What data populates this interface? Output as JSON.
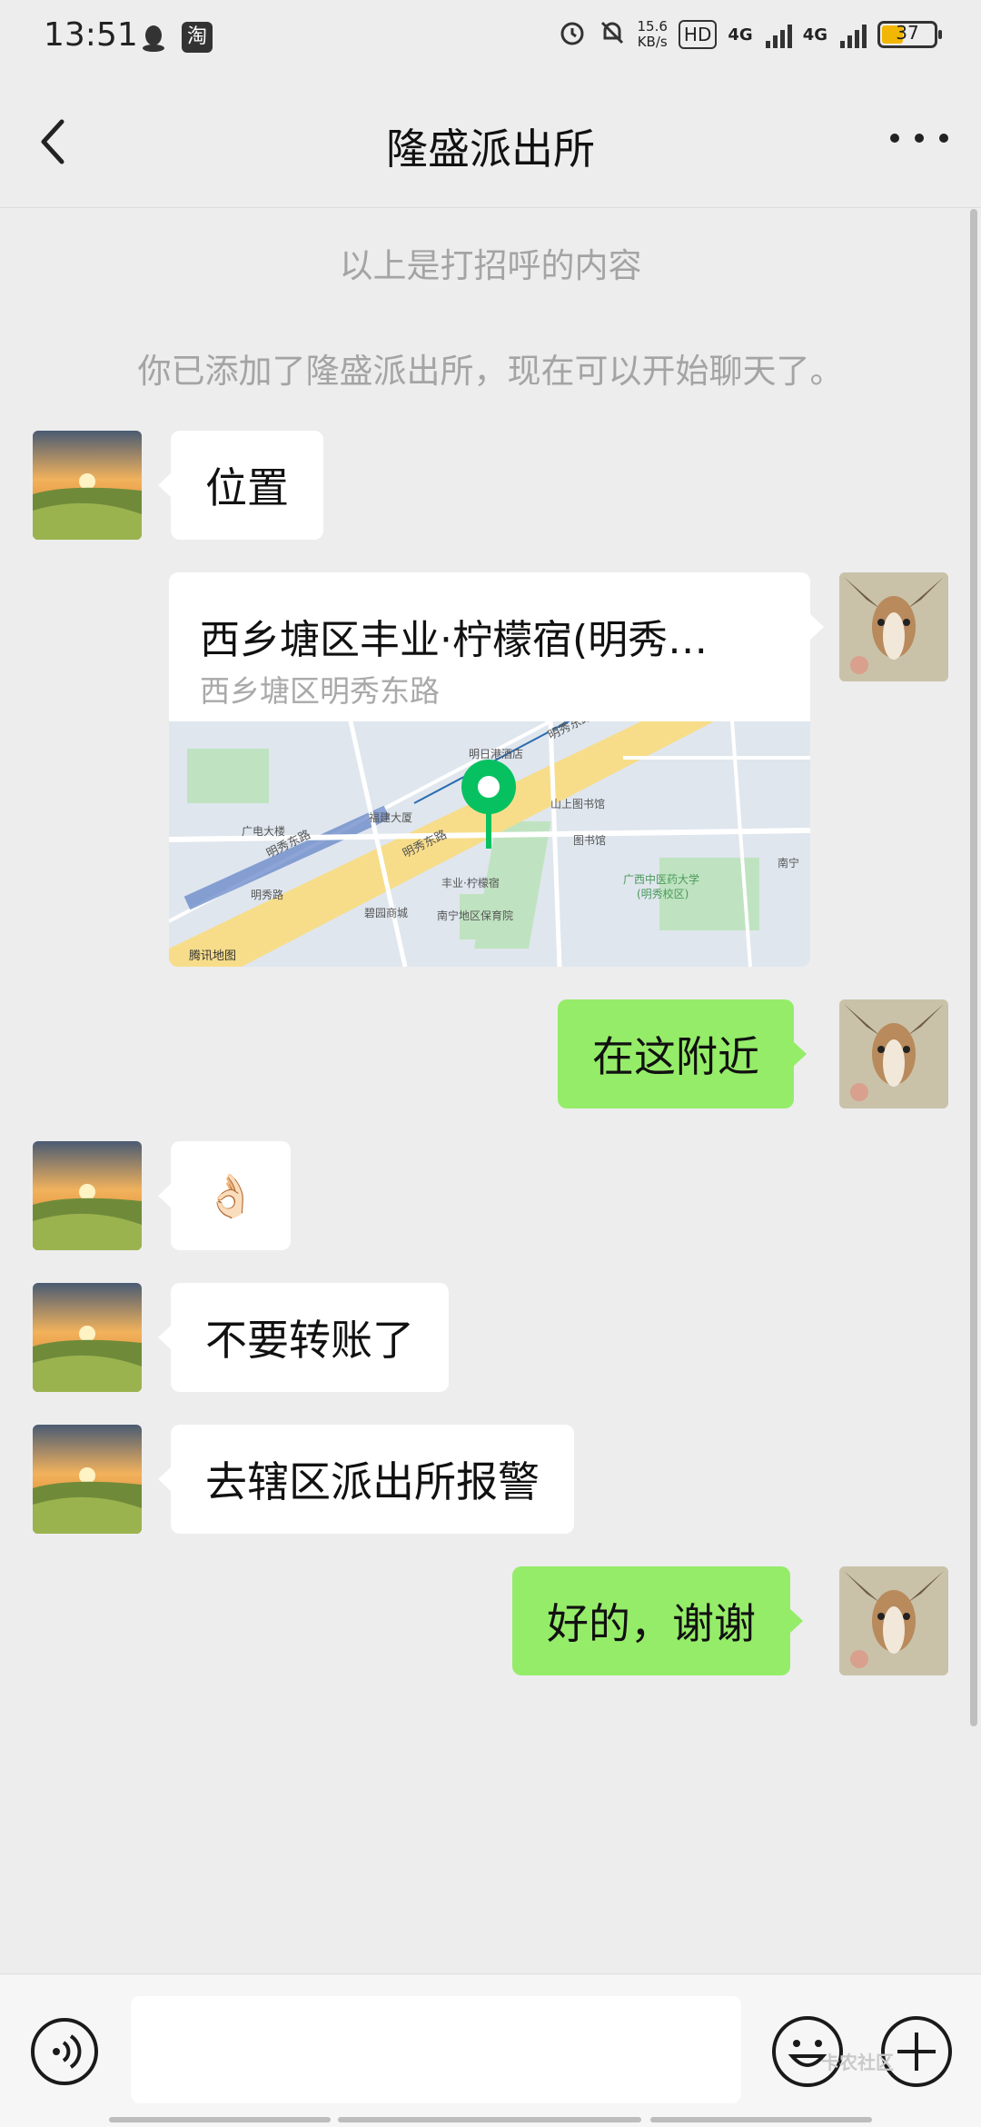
{
  "status_bar": {
    "time": "13:51",
    "left_icons": [
      "qq-icon",
      "taobao-icon"
    ],
    "taobao_glyph": "淘",
    "speed_value": "15.6",
    "speed_unit": "KB/s",
    "hd_label": "HD",
    "sim1_network": "4G",
    "sim2_network": "4G",
    "battery": "37",
    "battery_color": "#f2b705"
  },
  "header": {
    "title": "隆盛派出所"
  },
  "system_messages": {
    "greeting_note": "以上是打招呼的内容",
    "added_note": "你已添加了隆盛派出所，现在可以开始聊天了。"
  },
  "messages": {
    "m1": {
      "side": "in",
      "text": "位置"
    },
    "m2": {
      "side": "out",
      "type": "location",
      "title": "西乡塘区丰业·柠檬宿(明秀…",
      "address": "西乡塘区明秀东路",
      "map_labels": [
        "明秀东路",
        "明秀东路",
        "明秀路",
        "福建大厦",
        "广电大楼",
        "山上图书馆",
        "图书馆",
        "广西中医药大学",
        "(明秀校区)",
        "丰业·柠檬宿",
        "碧园商城",
        "南宁地区保育院",
        "腾讯地图",
        "明日港酒店",
        "南宁"
      ]
    },
    "m3": {
      "side": "out",
      "text": "在这附近"
    },
    "m4": {
      "side": "in",
      "text": "👌🏻"
    },
    "m5": {
      "side": "in",
      "text": "不要转账了"
    },
    "m6": {
      "side": "in",
      "text": "去辖区派出所报警"
    },
    "m7": {
      "side": "out",
      "text": "好的，谢谢"
    }
  },
  "colors": {
    "background": "#ededed",
    "bubble_out": "#95ec69",
    "bubble_in": "#ffffff",
    "map_pin": "#07c160"
  },
  "input_bar": {
    "icons": [
      "voice-icon",
      "emoji-icon",
      "plus-icon"
    ]
  },
  "watermark": "卡农社区"
}
